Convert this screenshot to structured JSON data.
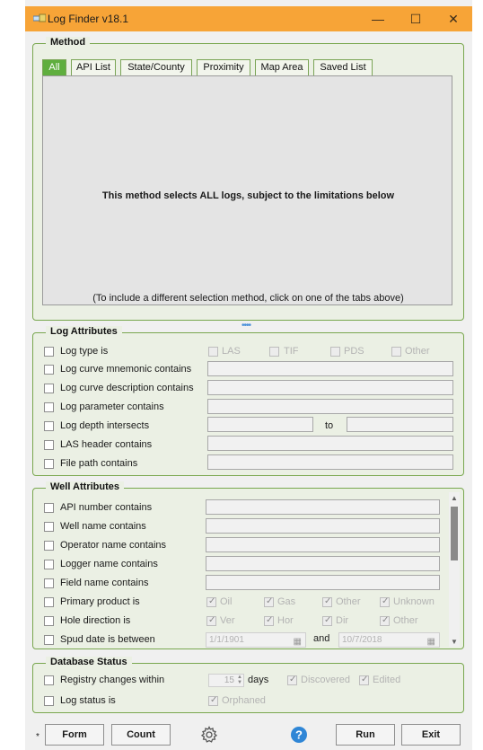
{
  "window": {
    "title": "Log Finder  v18.1",
    "minimize": "—",
    "maximize": "☐",
    "close": "✕"
  },
  "method": {
    "legend": "Method",
    "tabs": [
      "All",
      "API List",
      "State/County",
      "Proximity",
      "Map Area",
      "Saved List"
    ],
    "active_tab": "All",
    "message": "This method selects ALL logs, subject to the limitations below",
    "hint": "(To include a different selection method, click on one of the tabs above)"
  },
  "log_attributes": {
    "legend": "Log Attributes",
    "log_type_label": "Log type is",
    "log_types": [
      "LAS",
      "TIF",
      "PDS",
      "Other"
    ],
    "mnemonic_label": "Log curve mnemonic contains",
    "description_label": "Log curve description contains",
    "parameter_label": "Log parameter contains",
    "depth_label": "Log depth intersects",
    "depth_to": "to",
    "las_header_label": "LAS header contains",
    "file_path_label": "File path contains"
  },
  "well_attributes": {
    "legend": "Well Attributes",
    "api_label": "API number contains",
    "well_name_label": "Well name contains",
    "operator_label": "Operator name contains",
    "logger_label": "Logger name contains",
    "field_label": "Field name contains",
    "primary_product_label": "Primary product is",
    "products": [
      "Oil",
      "Gas",
      "Other",
      "Unknown"
    ],
    "hole_direction_label": "Hole direction is",
    "directions": [
      "Ver",
      "Hor",
      "Dir",
      "Other"
    ],
    "spud_label": "Spud date is between",
    "spud_from": "1/1/1901",
    "spud_and": "and",
    "spud_to": "10/7/2018"
  },
  "database_status": {
    "legend": "Database Status",
    "registry_label": "Registry changes within",
    "days_value": "15",
    "days_label": "days",
    "discovered_label": "Discovered",
    "edited_label": "Edited",
    "log_status_label": "Log status is",
    "orphaned_label": "Orphaned"
  },
  "footer": {
    "star": "*",
    "form": "Form",
    "count": "Count",
    "run": "Run",
    "exit": "Exit"
  },
  "colors": {
    "titlebar": "#f7a437",
    "accent_green": "#5fae3e",
    "help_blue": "#2f86d6"
  },
  "icons": {
    "settings": "gear-icon",
    "help": "help-icon",
    "app": "app-icon"
  }
}
